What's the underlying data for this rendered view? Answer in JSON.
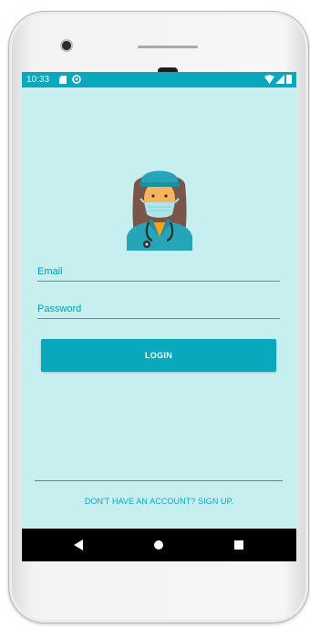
{
  "status_bar": {
    "time": "10:33",
    "icons": [
      "sd-card-icon",
      "sync-icon",
      "wifi-icon",
      "signal-icon",
      "battery-icon"
    ]
  },
  "avatar": {
    "icon": "doctor-avatar-icon"
  },
  "login_form": {
    "email_placeholder": "Email",
    "email_value": "",
    "password_placeholder": "Password",
    "password_value": "",
    "login_label": "LOGIN"
  },
  "footer": {
    "signup_text": "DON'T HAVE AN ACCOUNT? SIGN UP."
  },
  "nav_bar": {
    "icons": [
      "back-icon",
      "home-icon",
      "recents-icon"
    ]
  },
  "colors": {
    "primary": "#0aa8bd",
    "screen_background": "#c8eff0",
    "nav_background": "#000000"
  }
}
